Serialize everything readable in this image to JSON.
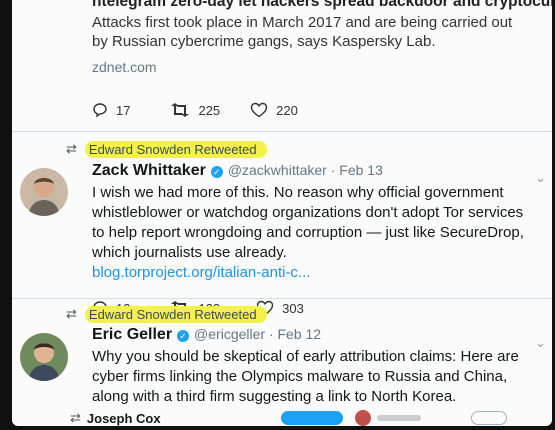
{
  "prev_card": {
    "title": "ntelegram zero-day let hackers spread backdoor and cryptocurrency-...",
    "description": "Attacks first took place in March 2017 and are being carried out by Russian cybercrime gangs, says Kaspersky Lab.",
    "domain": "zdnet.com",
    "replies": "17",
    "retweets": "225",
    "likes": "220"
  },
  "tweets": [
    {
      "retweeted_by": "Edward Snowden Retweeted",
      "name": "Zack Whittaker",
      "handle": "@zackwhittaker · Feb 13",
      "text": "I wish we had more of this. No reason why official government whistleblower or watchdog organizations don't adopt Tor services to help report wrongdoing and corruption — just like SecureDrop, which journalists use already.",
      "link": "blog.torproject.org/italian-anti-c...",
      "replies": "13",
      "retweets": "133",
      "likes": "303"
    },
    {
      "retweeted_by": "Edward Snowden Retweeted",
      "name": "Eric Geller",
      "handle": "@ericgeller · Feb 12",
      "text": "Why you should be skeptical of early attribution claims: Here are cyber firms linking the Olympics malware to Russia and China, along with a third firm suggesting a link to North Korea."
    }
  ],
  "footer": {
    "next_name": "Joseph Cox"
  },
  "colors": {
    "highlight": "#f4f24a",
    "link": "#1b95e0",
    "verified": "#1da1f2"
  }
}
